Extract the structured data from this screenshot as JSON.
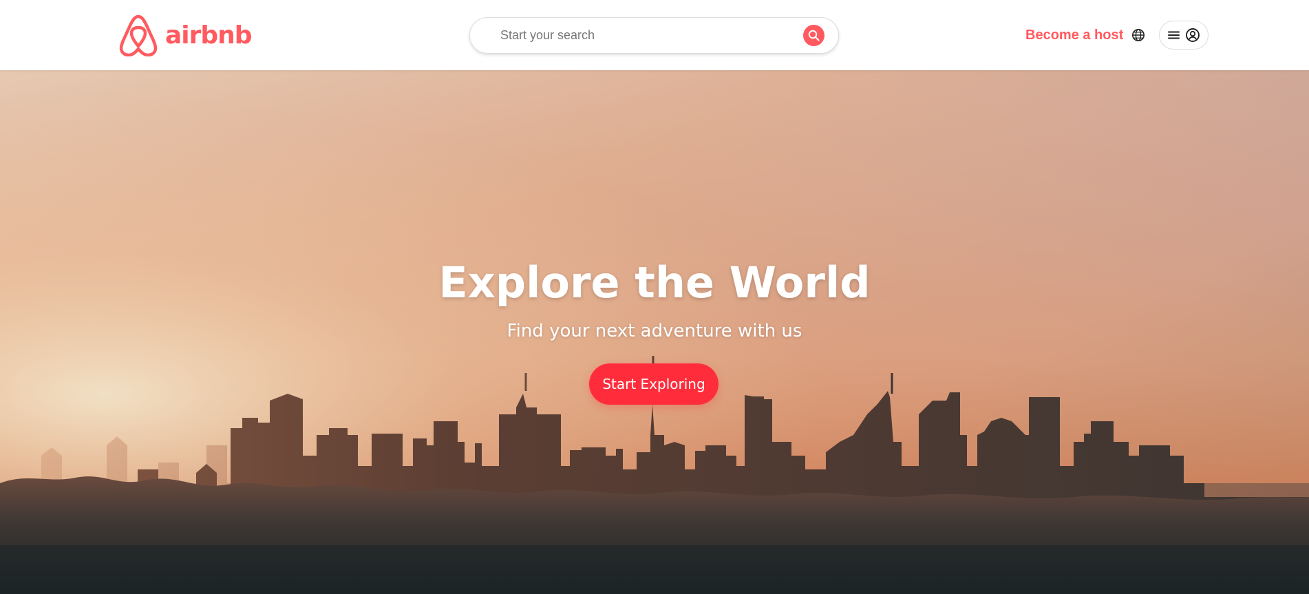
{
  "header": {
    "logo_text": "airbnb",
    "search": {
      "placeholder": "Start your search"
    },
    "become_host_label": "Become a host",
    "icons": {
      "logo": "airbnb-belo-icon",
      "search": "search-icon",
      "language": "globe-icon",
      "menu": "hamburger-menu-icon",
      "profile": "user-circle-icon"
    }
  },
  "hero": {
    "title": "Explore the World",
    "subtitle": "Find your next adventure with us",
    "cta_label": "Start Exploring"
  },
  "colors": {
    "brand": "#ff5a5f",
    "cta": "#ff2d3c",
    "hero_text": "#ffffff"
  }
}
